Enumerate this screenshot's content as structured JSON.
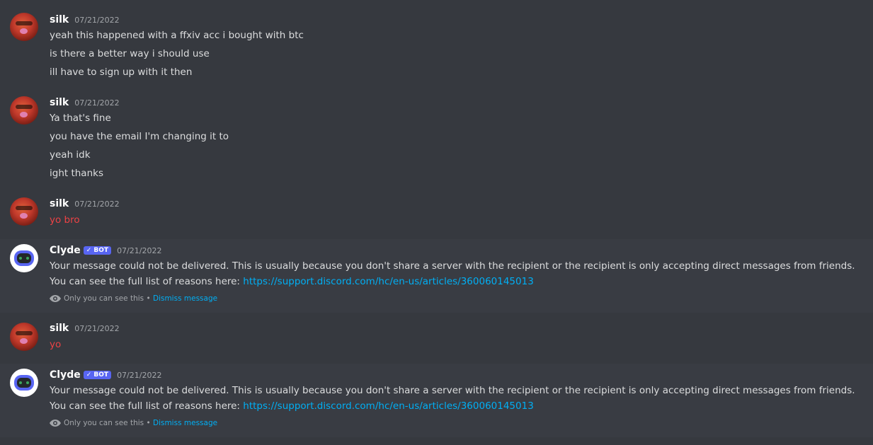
{
  "colors": {
    "background": "#36393f",
    "failed_text": "#ed4245",
    "link": "#00aff4",
    "bot_badge": "#5865f2"
  },
  "messages": [
    {
      "author": "silk",
      "timestamp": "07/21/2022",
      "avatar_icon": "red-muppet-avatar",
      "lines": [
        "yeah this happened with a ffxiv acc i bought with btc",
        "is there a better way i should use",
        "ill have to sign up with it then"
      ]
    },
    {
      "author": "silk",
      "timestamp": "07/21/2022",
      "avatar_icon": "red-muppet-avatar",
      "lines": [
        "Ya that's fine",
        "you have the email I'm changing it to",
        "yeah idk",
        "ight thanks"
      ]
    },
    {
      "author": "silk",
      "timestamp": "07/21/2022",
      "avatar_icon": "red-muppet-avatar",
      "lines": [
        "yo bro"
      ],
      "failed": true
    },
    {
      "author": "Clyde",
      "bot_badge": "BOT",
      "timestamp": "07/21/2022",
      "avatar_icon": "clyde-robot-avatar",
      "line1": "Your message could not be delivered. This is usually because you don't share a server with the recipient or the recipient is only accepting direct messages from friends.",
      "line2_prefix": "You can see the full list of reasons here: ",
      "line2_link": "https://support.discord.com/hc/en-us/articles/360060145013",
      "note": "Only you can see this",
      "separator": " • ",
      "dismiss": "Dismiss message"
    },
    {
      "author": "silk",
      "timestamp": "07/21/2022",
      "avatar_icon": "red-muppet-avatar",
      "lines": [
        "yo"
      ],
      "failed": true
    },
    {
      "author": "Clyde",
      "bot_badge": "BOT",
      "timestamp": "07/21/2022",
      "avatar_icon": "clyde-robot-avatar",
      "line1": "Your message could not be delivered. This is usually because you don't share a server with the recipient or the recipient is only accepting direct messages from friends.",
      "line2_prefix": "You can see the full list of reasons here: ",
      "line2_link": "https://support.discord.com/hc/en-us/articles/360060145013",
      "note": "Only you can see this",
      "separator": " • ",
      "dismiss": "Dismiss message"
    }
  ]
}
